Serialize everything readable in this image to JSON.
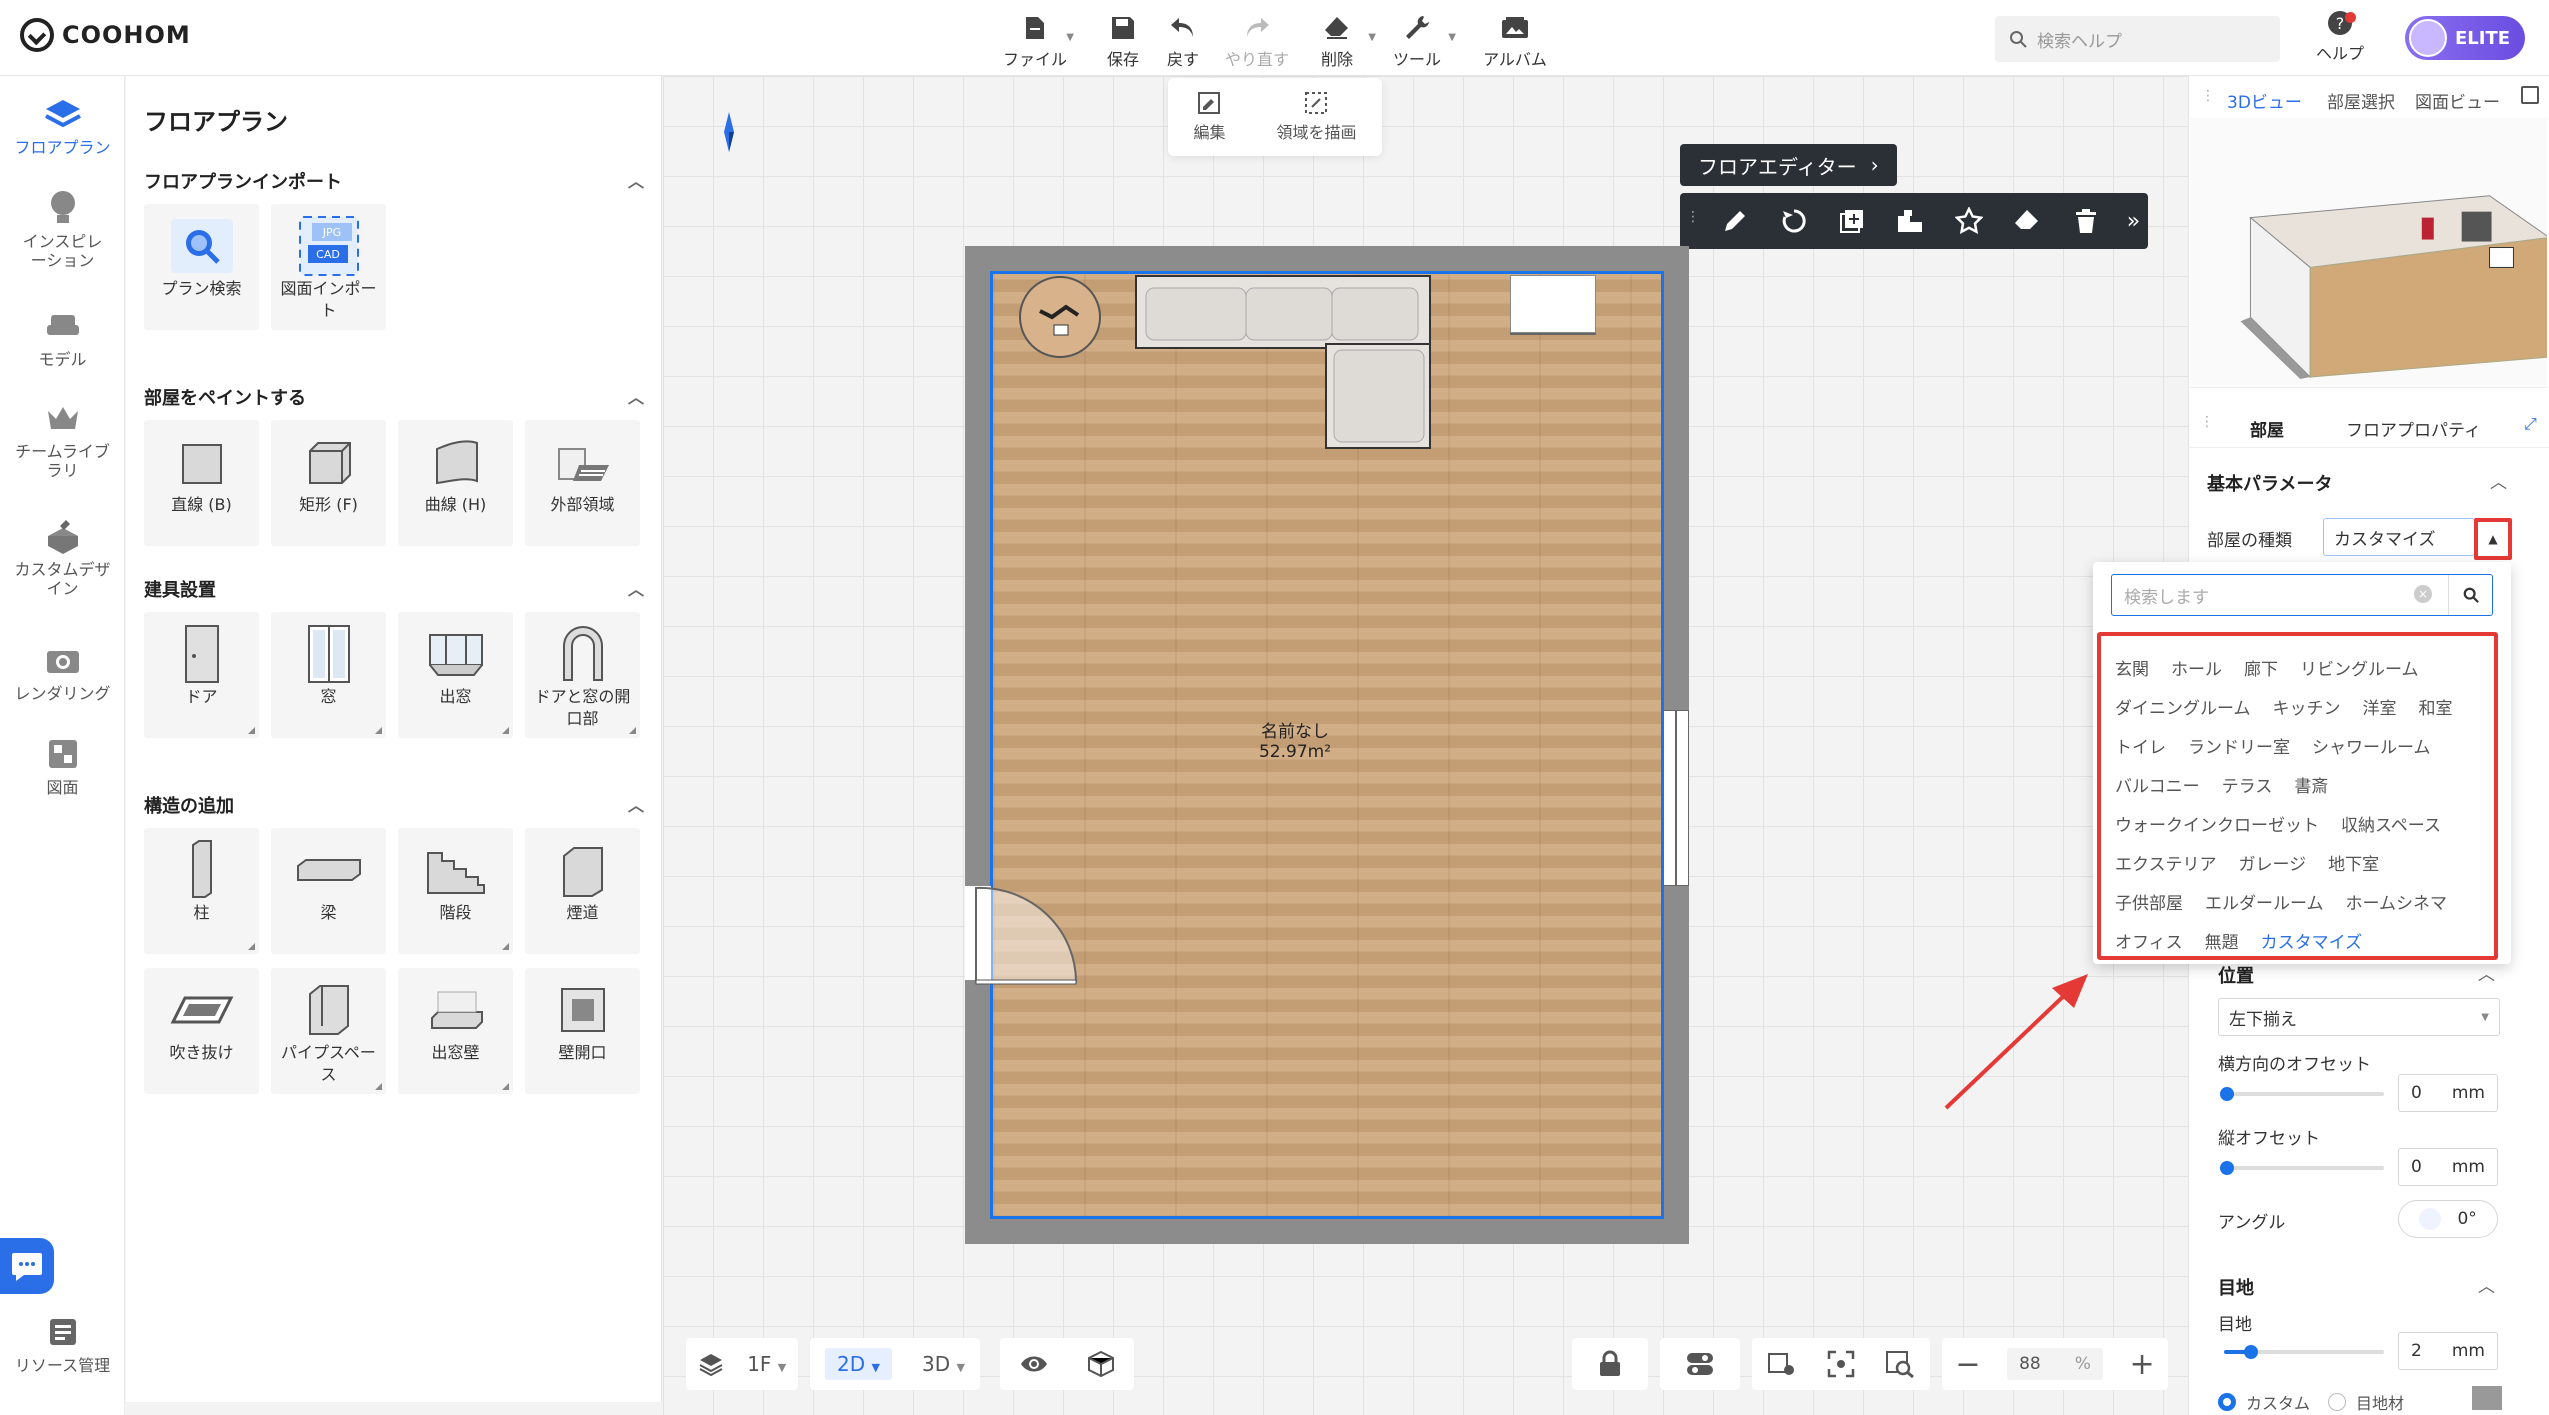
{
  "app": {
    "brand": "COOHOM"
  },
  "toolbar": {
    "file": "ファイル",
    "save": "保存",
    "undo": "戻す",
    "redo": "やり直す",
    "delete": "削除",
    "tools": "ツール",
    "album": "アルバム"
  },
  "search": {
    "placeholder": "検索ヘルプ"
  },
  "help": {
    "label": "ヘルプ"
  },
  "account": {
    "badge": "ELITE"
  },
  "rail": {
    "items": [
      "フロアプラン",
      "インスピレーション",
      "モデル",
      "チームライブラリ",
      "カスタムデザイン",
      "レンダリング",
      "図面",
      "リソース管理"
    ]
  },
  "panel": {
    "title": "フロアプラン",
    "sections": [
      {
        "title": "フロアプランインポート",
        "items": [
          "プラン検索",
          "図面インポート"
        ]
      },
      {
        "title": "部屋をペイントする",
        "items": [
          "直線 (B)",
          "矩形 (F)",
          "曲線 (H)",
          "外部領域"
        ]
      },
      {
        "title": "建具設置",
        "items": [
          "ドア",
          "窓",
          "出窓",
          "ドアと窓の開口部"
        ]
      },
      {
        "title": "構造の追加",
        "items": [
          "柱",
          "梁",
          "階段",
          "煙道",
          "吹き抜け",
          "パイプスペース",
          "出窓壁",
          "壁開口"
        ]
      }
    ]
  },
  "canvas": {
    "edit_toolbar": {
      "edit": "編集",
      "draw_area": "領域を描画"
    },
    "floor_editor": "フロアエディター",
    "room": {
      "name": "名前なし",
      "area": "52.97m²"
    }
  },
  "bottom": {
    "floor": "1F",
    "view2d": "2D",
    "view3d": "3D",
    "zoom": "88",
    "zoom_unit": "%"
  },
  "right": {
    "view_tabs": [
      "3Dビュー",
      "部屋選択",
      "図面ビュー"
    ],
    "prop_tabs": [
      "部屋",
      "フロアプロパティ"
    ],
    "basic": "基本パラメータ",
    "room_type_label": "部屋の種類",
    "room_type_value": "カスタマイズ",
    "position": "位置",
    "align": "左下揃え",
    "h_offset": "横方向のオフセット",
    "h_offset_value": "0",
    "v_offset": "縦オフセット",
    "v_offset_value": "0",
    "unit": "mm",
    "angle": "アングル",
    "angle_value": "0°",
    "joint_head": "目地",
    "joint_label": "目地",
    "joint_value": "2",
    "joint_opts": [
      "カスタム",
      "目地材"
    ]
  },
  "dropdown": {
    "placeholder": "検索します",
    "rows": [
      [
        "玄関",
        "ホール",
        "廊下",
        "リビングルーム"
      ],
      [
        "ダイニングルーム",
        "キッチン",
        "洋室",
        "和室"
      ],
      [
        "トイレ",
        "ランドリー室",
        "シャワールーム"
      ],
      [
        "バルコニー",
        "テラス",
        "書斎"
      ],
      [
        "ウォークインクローゼット",
        "収納スペース"
      ],
      [
        "エクステリア",
        "ガレージ",
        "地下室"
      ],
      [
        "子供部屋",
        "エルダールーム",
        "ホームシネマ"
      ],
      [
        "オフィス",
        "無題",
        "カスタマイズ"
      ]
    ],
    "selected": "カスタマイズ"
  },
  "colors": {
    "accent": "#2a6fe8",
    "highlight": "#e53935",
    "floor": "#c9a57c"
  }
}
